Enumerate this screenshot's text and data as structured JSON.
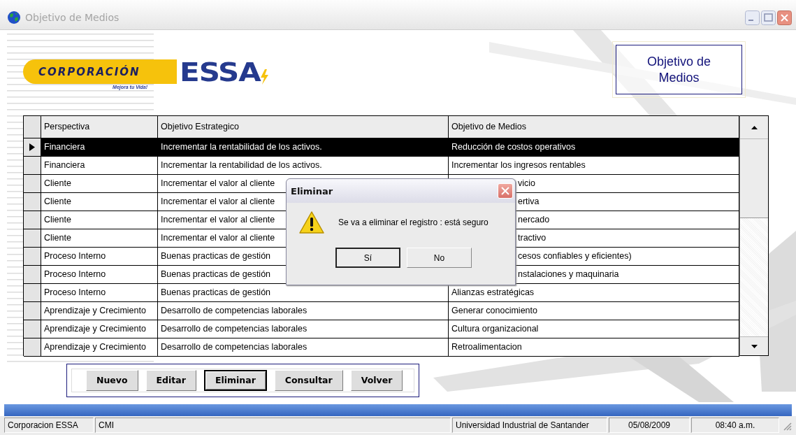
{
  "window": {
    "title": "Objetivo de Medios"
  },
  "logo": {
    "name": "CORPORACIÓN",
    "tagline": "Mejora tu Vida!",
    "brand": "ESSA"
  },
  "form_title": "Objetivo de Medios",
  "table": {
    "columns": [
      "Perspectiva",
      "Objetivo Estrategico",
      "Objetivo de Medios"
    ],
    "rows": [
      {
        "selected": true,
        "perspectiva": "Financiera",
        "estrategico": "Incrementar la rentabilidad de los activos.",
        "medios": "Reducción de costos operativos",
        "medios_obscured": false
      },
      {
        "selected": false,
        "perspectiva": "Financiera",
        "estrategico": "Incrementar la rentabilidad de los activos.",
        "medios": "Incrementar los ingresos rentables",
        "medios_obscured": false
      },
      {
        "selected": false,
        "perspectiva": "Cliente",
        "estrategico": "Incrementar el valor al cliente",
        "medios": "vicio",
        "medios_obscured": true
      },
      {
        "selected": false,
        "perspectiva": "Cliente",
        "estrategico": "Incrementar el valor al cliente",
        "medios": "ertiva",
        "medios_obscured": true
      },
      {
        "selected": false,
        "perspectiva": "Cliente",
        "estrategico": "Incrementar el valor al cliente",
        "medios": "nercado",
        "medios_obscured": true
      },
      {
        "selected": false,
        "perspectiva": "Cliente",
        "estrategico": "Incrementar el valor al cliente",
        "medios": "tractivo",
        "medios_obscured": true
      },
      {
        "selected": false,
        "perspectiva": "Proceso Interno",
        "estrategico": "Buenas practicas de gestión",
        "medios": "cesos confiables y eficientes)",
        "medios_obscured": true
      },
      {
        "selected": false,
        "perspectiva": "Proceso Interno",
        "estrategico": "Buenas practicas de gestión",
        "medios": "nstalaciones y maquinaria",
        "medios_obscured": true
      },
      {
        "selected": false,
        "perspectiva": "Proceso Interno",
        "estrategico": "Buenas practicas de gestión",
        "medios": "Alianzas estratégicas",
        "medios_obscured": false
      },
      {
        "selected": false,
        "perspectiva": "Aprendizaje y Crecimiento",
        "estrategico": "Desarrollo de competencias laborales",
        "medios": "Generar conocimiento",
        "medios_obscured": false
      },
      {
        "selected": false,
        "perspectiva": "Aprendizaje y Crecimiento",
        "estrategico": "Desarrollo de competencias laborales",
        "medios": "Cultura organizacional",
        "medios_obscured": false
      },
      {
        "selected": false,
        "perspectiva": "Aprendizaje y Crecimiento",
        "estrategico": "Desarrollo de competencias laborales",
        "medios": "Retroalimentacion",
        "medios_obscured": false
      }
    ]
  },
  "buttons": [
    {
      "label": "Nuevo",
      "focused": false
    },
    {
      "label": "Editar",
      "focused": false
    },
    {
      "label": "Eliminar",
      "focused": true
    },
    {
      "label": "Consultar",
      "focused": false
    },
    {
      "label": "Volver",
      "focused": false
    }
  ],
  "dialog": {
    "title": "Eliminar",
    "message": "Se va a eliminar el registro : está seguro",
    "buttons": [
      {
        "label": "Sí",
        "focused": true
      },
      {
        "label": "No",
        "focused": false
      }
    ]
  },
  "status_bar": [
    "Corporacion ESSA",
    "CMI",
    "Universidad Industrial de Santander",
    "05/08/2009",
    "08:40 a.m."
  ]
}
